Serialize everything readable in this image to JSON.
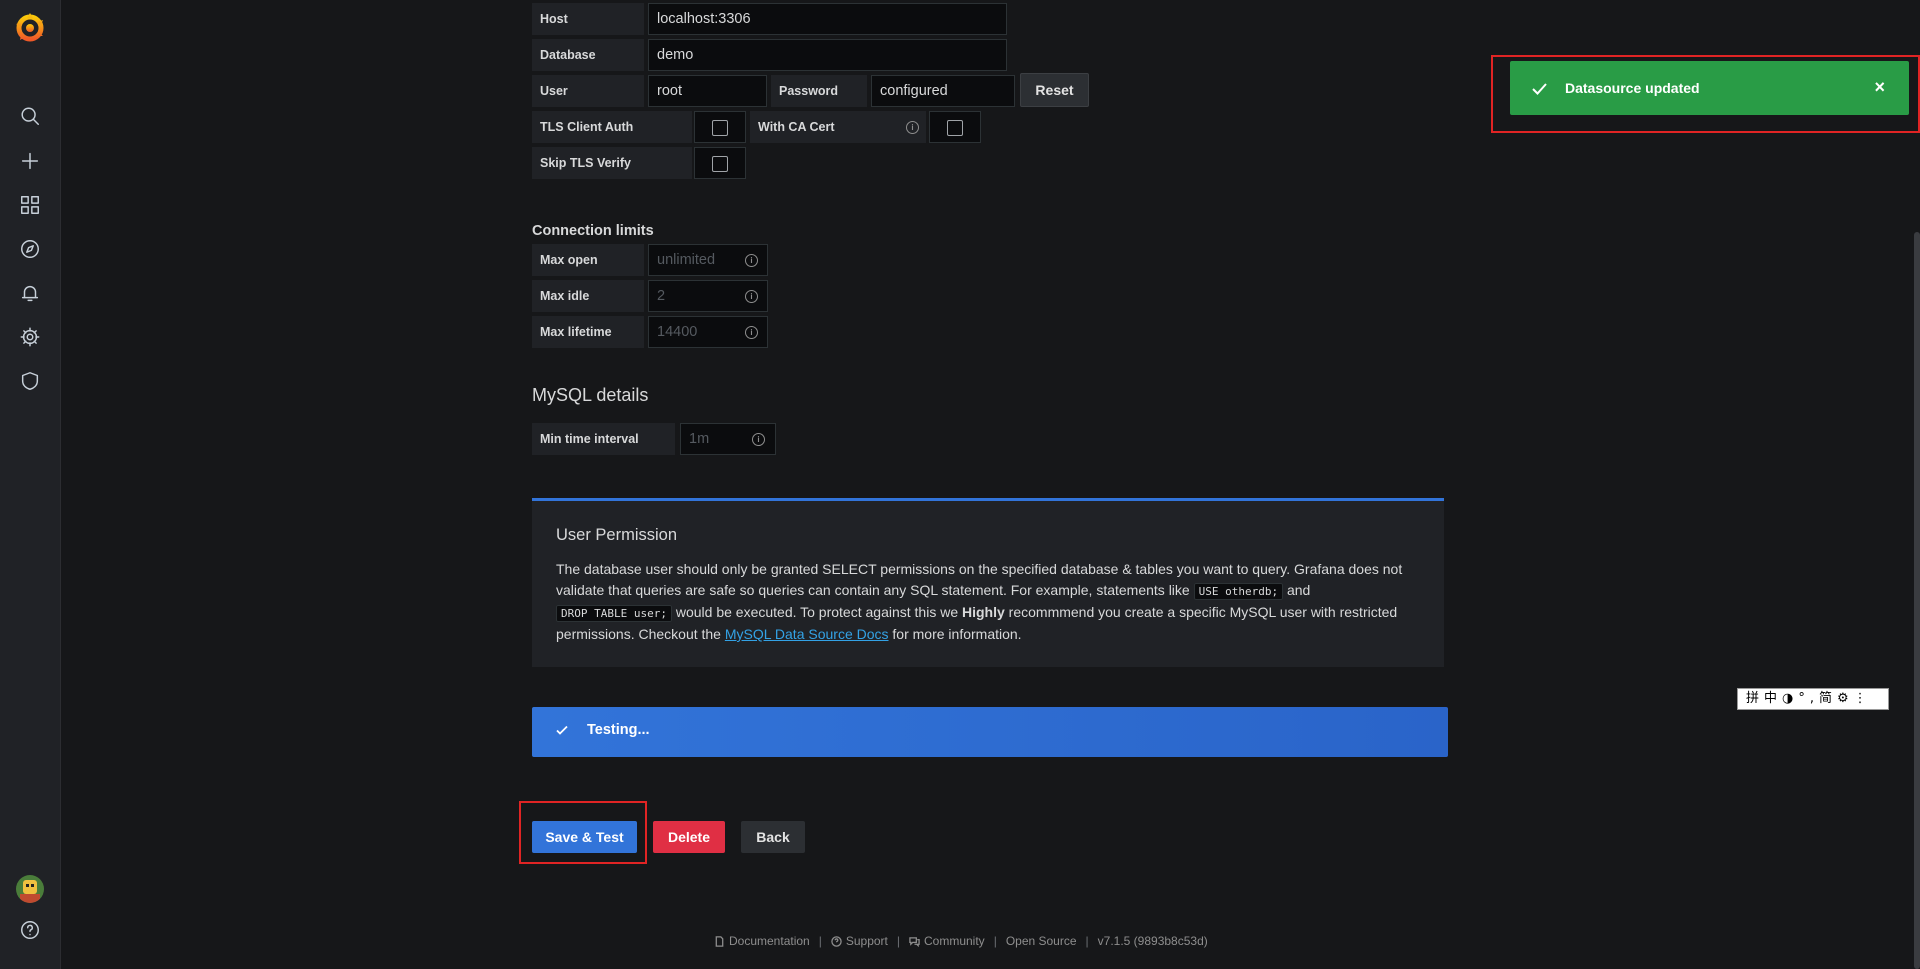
{
  "sidebar": {
    "items": [
      "search-icon",
      "plus-icon",
      "dashboards-icon",
      "explore-icon",
      "alerting-icon",
      "configuration-icon",
      "server-admin-icon"
    ],
    "bottom": [
      "user-avatar",
      "help-icon"
    ]
  },
  "connection": {
    "host_label": "Host",
    "host_value": "localhost:3306",
    "database_label": "Database",
    "database_value": "demo",
    "user_label": "User",
    "user_value": "root",
    "password_label": "Password",
    "password_value": "configured",
    "reset_label": "Reset",
    "tls_client_auth_label": "TLS Client Auth",
    "with_ca_cert_label": "With CA Cert",
    "skip_tls_label": "Skip TLS Verify"
  },
  "limits": {
    "title": "Connection limits",
    "max_open_label": "Max open",
    "max_open_placeholder": "unlimited",
    "max_idle_label": "Max idle",
    "max_idle_placeholder": "2",
    "max_lifetime_label": "Max lifetime",
    "max_lifetime_placeholder": "14400"
  },
  "mysql": {
    "title": "MySQL details",
    "min_interval_label": "Min time interval",
    "min_interval_placeholder": "1m"
  },
  "permission": {
    "title": "User Permission",
    "t1": "The database user should only be granted SELECT permissions on the specified database & tables you want to query. Grafana does not validate that queries are safe so queries can contain any SQL statement. For example, statements like ",
    "code1": "USE otherdb;",
    "t2": " and",
    "code2": "DROP TABLE user;",
    "t3": " would be executed. To protect against this we ",
    "bold": "Highly",
    "t4": " recommmend you create a specific MySQL user with restricted permissions. Checkout the ",
    "link": "MySQL Data Source Docs",
    "t5": " for more information."
  },
  "status": {
    "testing": "Testing..."
  },
  "actions": {
    "save": "Save & Test",
    "delete": "Delete",
    "back": "Back"
  },
  "footer": {
    "documentation": "Documentation",
    "support": "Support",
    "community": "Community",
    "open_source": "Open Source",
    "version": "v7.1.5 (9893b8c53d)"
  },
  "toast": {
    "message": "Datasource updated",
    "close": "×"
  },
  "ime": {
    "text": "拼中◑°,简⚙⋮"
  },
  "colors": {
    "accent": "#3274d9",
    "success": "#299c46",
    "danger": "#e02f44",
    "highlight": "#e02424"
  }
}
